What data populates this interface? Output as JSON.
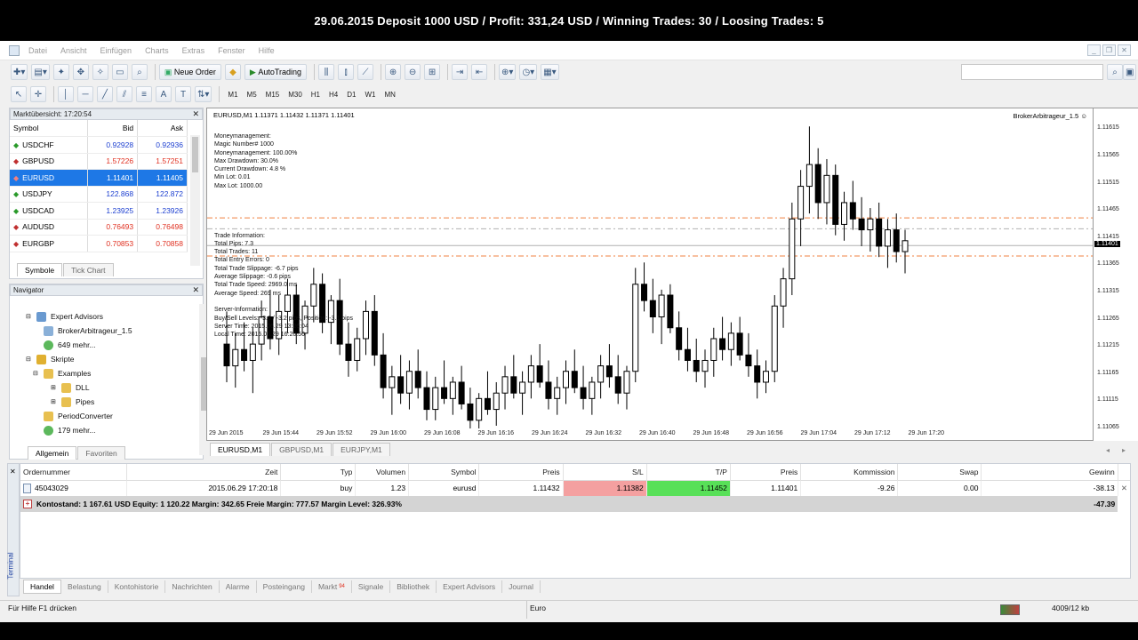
{
  "banner": "29.06.2015 Deposit 1000 USD / Profit: 331,24 USD / Winning Trades: 30 / Loosing Trades: 5",
  "menu": [
    "Datei",
    "Ansicht",
    "Einfügen",
    "Charts",
    "Extras",
    "Fenster",
    "Hilfe"
  ],
  "toolbar": {
    "neue_order": "Neue Order",
    "autotrading": "AutoTrading"
  },
  "timeframes": [
    "M1",
    "M5",
    "M15",
    "M30",
    "H1",
    "H4",
    "D1",
    "W1",
    "MN"
  ],
  "marketwatch": {
    "title": "Marktübersicht: 17:20:54",
    "headers": {
      "symbol": "Symbol",
      "bid": "Bid",
      "ask": "Ask"
    },
    "rows": [
      {
        "symbol": "USDCHF",
        "bid": "0.92928",
        "ask": "0.92936",
        "bid_color": "#1c3fd0",
        "ask_color": "#1c3fd0"
      },
      {
        "symbol": "GBPUSD",
        "bid": "1.57226",
        "ask": "1.57251",
        "bid_color": "#e03020",
        "ask_color": "#e03020"
      },
      {
        "symbol": "EURUSD",
        "bid": "1.11401",
        "ask": "1.11405",
        "bid_color": "#ffffff",
        "ask_color": "#ffffff"
      },
      {
        "symbol": "USDJPY",
        "bid": "122.868",
        "ask": "122.872",
        "bid_color": "#1c3fd0",
        "ask_color": "#1c3fd0"
      },
      {
        "symbol": "USDCAD",
        "bid": "1.23925",
        "ask": "1.23926",
        "bid_color": "#1c3fd0",
        "ask_color": "#1c3fd0"
      },
      {
        "symbol": "AUDUSD",
        "bid": "0.76493",
        "ask": "0.76498",
        "bid_color": "#e03020",
        "ask_color": "#e03020"
      },
      {
        "symbol": "EURGBP",
        "bid": "0.70853",
        "ask": "0.70858",
        "bid_color": "#e03020",
        "ask_color": "#e03020"
      }
    ],
    "tabs": [
      "Symbole",
      "Tick Chart"
    ]
  },
  "navigator": {
    "title": "Navigator",
    "items": [
      "Expert Advisors",
      "BrokerArbitrageur_1.5",
      "649 mehr...",
      "Skripte",
      "Examples",
      "DLL",
      "Pipes",
      "PeriodConverter",
      "179 mehr..."
    ],
    "tabs": [
      "Allgemein",
      "Favoriten"
    ]
  },
  "chart": {
    "header": "EURUSD,M1  1.11371 1.11432 1.11371 1.11401",
    "ea_label": "BrokerArbitrageur_1.5",
    "info_lines": [
      "Moneymanagement:",
      "Magic Number# 1000",
      "Moneymanagement: 100.00%",
      "Max Drawdown: 30.0%",
      "Current Drawdown: 4.8 %",
      "Min Lot: 0.01",
      "Max Lot: 1000.00",
      "",
      "",
      "",
      "",
      "",
      "Trade Information:",
      "Total Pips: 7.3",
      "Total Trades: 11",
      "Total Entry Errors: 0",
      "Total Trade Slippage: -6.7 pips",
      "Average Slippage: -0.6 pips",
      "Total Trade Speed: 2969.0 ms",
      "Average Speed: 269 ms",
      "",
      "Server-Information:",
      "Buy/Sell Levels: -3.6 / -3.2 pips, Position: -3.1 pips",
      "Server Time: 2015.06.29 13:26:04",
      "Local Time: 2015.06.29 16:20:50"
    ],
    "price_ticks": [
      "1.11615",
      "1.11565",
      "1.11515",
      "1.11465",
      "1.11415",
      "1.11365",
      "1.11315",
      "1.11265",
      "1.11215",
      "1.11165",
      "1.11115",
      "1.11065"
    ],
    "current_price": "1.11401",
    "time_ticks": [
      "29 Jun 2015",
      "29 Jun 15:44",
      "29 Jun 15:52",
      "29 Jun 16:00",
      "29 Jun 16:08",
      "29 Jun 16:16",
      "29 Jun 16:24",
      "29 Jun 16:32",
      "29 Jun 16:40",
      "29 Jun 16:48",
      "29 Jun 16:56",
      "29 Jun 17:04",
      "29 Jun 17:12",
      "29 Jun 17:20"
    ],
    "tabs": [
      "EURUSD,M1",
      "GBPUSD,M1",
      "EURJPY,M1"
    ]
  },
  "terminal": {
    "headers": [
      "Ordernummer",
      "Zeit",
      "Typ",
      "Volumen",
      "Symbol",
      "Preis",
      "S/L",
      "T/P",
      "Preis",
      "Kommission",
      "Swap",
      "Gewinn"
    ],
    "order": [
      "45043029",
      "2015.06.29 17:20:18",
      "buy",
      "1.23",
      "eurusd",
      "1.11432",
      "1.11382",
      "1.11452",
      "1.11401",
      "-9.26",
      "0.00",
      "-38.13"
    ],
    "balance_line": "Kontostand: 1 167.61 USD  Equity: 1 120.22  Margin: 342.65  Freie Margin: 777.57  Margin Level: 326.93%",
    "balance_profit": "-47.39",
    "side_label": "Terminal",
    "tabs": [
      "Handel",
      "Belastung",
      "Kontohistorie",
      "Nachrichten",
      "Alarme",
      "Posteingang",
      "Markt",
      "Signale",
      "Bibliothek",
      "Expert Advisors",
      "Journal"
    ],
    "markt_badge": "94"
  },
  "status": {
    "help": "Für Hilfe F1 drücken",
    "profile": "Euro",
    "traffic": "4009/12 kb"
  },
  "colors": {
    "sl_bg": "#f4a0a0",
    "tp_bg": "#58e058",
    "selected_row": "#1e78e6",
    "level_line": "#f08040"
  },
  "chart_data": {
    "type": "candlestick",
    "symbol": "EURUSD",
    "timeframe": "M1",
    "ylim": [
      1.11065,
      1.1164
    ],
    "candles": [
      [
        1.1122,
        1.1128,
        1.1115,
        1.1118
      ],
      [
        1.1118,
        1.1124,
        1.1114,
        1.1121
      ],
      [
        1.1121,
        1.1126,
        1.1117,
        1.1119
      ],
      [
        1.1119,
        1.1125,
        1.1113,
        1.1122
      ],
      [
        1.1122,
        1.113,
        1.1119,
        1.1127
      ],
      [
        1.1127,
        1.1132,
        1.1121,
        1.1123
      ],
      [
        1.1123,
        1.1131,
        1.112,
        1.1128
      ],
      [
        1.1128,
        1.1134,
        1.1124,
        1.1131
      ],
      [
        1.1131,
        1.1133,
        1.1122,
        1.1124
      ],
      [
        1.1124,
        1.113,
        1.1121,
        1.1129
      ],
      [
        1.1129,
        1.1136,
        1.1126,
        1.1133
      ],
      [
        1.1133,
        1.1135,
        1.1124,
        1.1126
      ],
      [
        1.1126,
        1.1131,
        1.1122,
        1.113
      ],
      [
        1.113,
        1.1134,
        1.112,
        1.1122
      ],
      [
        1.1122,
        1.1126,
        1.1116,
        1.1119
      ],
      [
        1.1119,
        1.1125,
        1.1117,
        1.1123
      ],
      [
        1.1123,
        1.113,
        1.112,
        1.1128
      ],
      [
        1.1128,
        1.1131,
        1.1118,
        1.112
      ],
      [
        1.112,
        1.1124,
        1.1112,
        1.1114
      ],
      [
        1.1114,
        1.1118,
        1.1109,
        1.1116
      ],
      [
        1.1116,
        1.112,
        1.1111,
        1.1113
      ],
      [
        1.1113,
        1.1119,
        1.111,
        1.1117
      ],
      [
        1.1117,
        1.1121,
        1.1112,
        1.1114
      ],
      [
        1.1114,
        1.1117,
        1.1108,
        1.111
      ],
      [
        1.111,
        1.1116,
        1.1108,
        1.1114
      ],
      [
        1.1114,
        1.1119,
        1.1111,
        1.1112
      ],
      [
        1.1112,
        1.1116,
        1.1109,
        1.1115
      ],
      [
        1.1115,
        1.1118,
        1.111,
        1.1111
      ],
      [
        1.1111,
        1.1114,
        1.1106,
        1.1108
      ],
      [
        1.1108,
        1.1113,
        1.1106,
        1.1112
      ],
      [
        1.1112,
        1.1117,
        1.1109,
        1.111
      ],
      [
        1.111,
        1.1115,
        1.1107,
        1.1113
      ],
      [
        1.1113,
        1.1118,
        1.111,
        1.1116
      ],
      [
        1.1116,
        1.112,
        1.1112,
        1.1113
      ],
      [
        1.1113,
        1.1117,
        1.1109,
        1.1115
      ],
      [
        1.1115,
        1.112,
        1.1112,
        1.1118
      ],
      [
        1.1118,
        1.1122,
        1.1114,
        1.1115
      ],
      [
        1.1115,
        1.1119,
        1.111,
        1.1112
      ],
      [
        1.1112,
        1.1116,
        1.1109,
        1.1114
      ],
      [
        1.1114,
        1.1119,
        1.1111,
        1.1117
      ],
      [
        1.1117,
        1.1121,
        1.1113,
        1.1114
      ],
      [
        1.1114,
        1.1118,
        1.111,
        1.1112
      ],
      [
        1.1112,
        1.1116,
        1.1109,
        1.1115
      ],
      [
        1.1115,
        1.112,
        1.1112,
        1.1118
      ],
      [
        1.1118,
        1.1122,
        1.1114,
        1.1116
      ],
      [
        1.1116,
        1.112,
        1.1111,
        1.1113
      ],
      [
        1.1113,
        1.1118,
        1.111,
        1.1117
      ],
      [
        1.1117,
        1.1136,
        1.1115,
        1.1133
      ],
      [
        1.1133,
        1.1137,
        1.1128,
        1.113
      ],
      [
        1.113,
        1.1134,
        1.1124,
        1.1127
      ],
      [
        1.1127,
        1.1132,
        1.1122,
        1.1131
      ],
      [
        1.1131,
        1.1133,
        1.1124,
        1.1125
      ],
      [
        1.1125,
        1.1128,
        1.1119,
        1.1121
      ],
      [
        1.1121,
        1.1125,
        1.1117,
        1.1119
      ],
      [
        1.1119,
        1.1123,
        1.1115,
        1.1117
      ],
      [
        1.1117,
        1.1121,
        1.1114,
        1.1119
      ],
      [
        1.1119,
        1.1125,
        1.1116,
        1.1123
      ],
      [
        1.1123,
        1.1127,
        1.1119,
        1.1121
      ],
      [
        1.1121,
        1.1126,
        1.1118,
        1.1124
      ],
      [
        1.1124,
        1.1127,
        1.1119,
        1.112
      ],
      [
        1.112,
        1.1124,
        1.1116,
        1.1118
      ],
      [
        1.1118,
        1.1121,
        1.1112,
        1.1115
      ],
      [
        1.1115,
        1.1119,
        1.1113,
        1.1117
      ],
      [
        1.1117,
        1.1131,
        1.1115,
        1.1129
      ],
      [
        1.1129,
        1.1136,
        1.1125,
        1.1134
      ],
      [
        1.1134,
        1.1148,
        1.1131,
        1.1145
      ],
      [
        1.1145,
        1.1154,
        1.114,
        1.1151
      ],
      [
        1.1151,
        1.1162,
        1.1146,
        1.1155
      ],
      [
        1.1155,
        1.1158,
        1.1145,
        1.1148
      ],
      [
        1.1148,
        1.1156,
        1.1144,
        1.1153
      ],
      [
        1.1153,
        1.1155,
        1.1142,
        1.1144
      ],
      [
        1.1144,
        1.115,
        1.1141,
        1.1148
      ],
      [
        1.1148,
        1.1152,
        1.1143,
        1.1145
      ],
      [
        1.1145,
        1.1149,
        1.114,
        1.1143
      ],
      [
        1.1143,
        1.1147,
        1.1139,
        1.1145
      ],
      [
        1.1145,
        1.1148,
        1.1138,
        1.114
      ],
      [
        1.114,
        1.1145,
        1.1136,
        1.1143
      ],
      [
        1.1143,
        1.1146,
        1.1137,
        1.1139
      ],
      [
        1.1139,
        1.1143,
        1.1135,
        1.1141
      ]
    ],
    "horizontal_levels": [
      1.11452,
      1.11432,
      1.11401,
      1.11382
    ]
  }
}
